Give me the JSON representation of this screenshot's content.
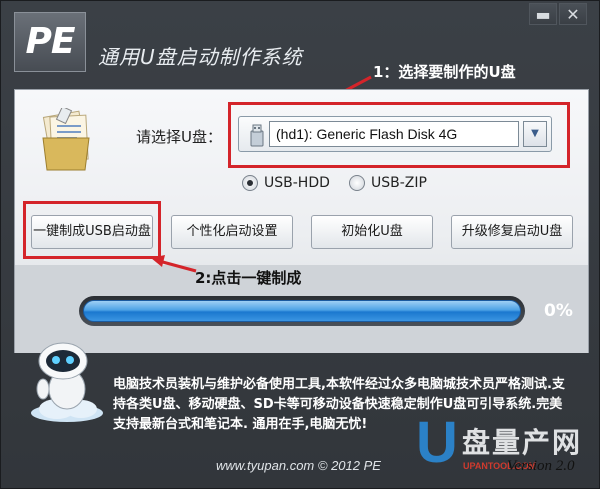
{
  "window": {
    "logo_text": "PE",
    "title": "通用U盘启动制作系统",
    "minimize_icon": "minimize-icon",
    "close_icon": "close-icon"
  },
  "annotations": {
    "step1": "1：选择要制作的U盘",
    "step2": "2:点击一键制成"
  },
  "disk_select": {
    "label": "请选择U盘：",
    "value": "(hd1): Generic Flash Disk 4G"
  },
  "boot_mode": {
    "options": [
      "USB-HDD",
      "USB-ZIP"
    ],
    "selected": "USB-HDD"
  },
  "buttons": {
    "one_click": "一键制成USB启动盘",
    "personalize": "个性化启动设置",
    "initialize": "初始化U盘",
    "upgrade": "升级修复启动U盘"
  },
  "progress": {
    "value": 0,
    "label": "0%"
  },
  "description": "电脑技术员装机与维护必备使用工具,本软件经过众多电脑城技术员严格测试.支持各类U盘、移动硬盘、SD卡等可移动设备快速稳定制作U盘可引导系统.完美支持最新台式和笔记本. 通用在手,电脑无忧!",
  "footer": {
    "copyright": "www.tyupan.com © 2012 PE",
    "version": "Version 2.0"
  },
  "watermark": {
    "letter": "U",
    "text": "盘量产网",
    "url": "UPANTOOL.COM"
  },
  "colors": {
    "annotation_red": "#d4242a",
    "progress_blue": "#2a8ae0",
    "window_dark": "#33373c"
  }
}
